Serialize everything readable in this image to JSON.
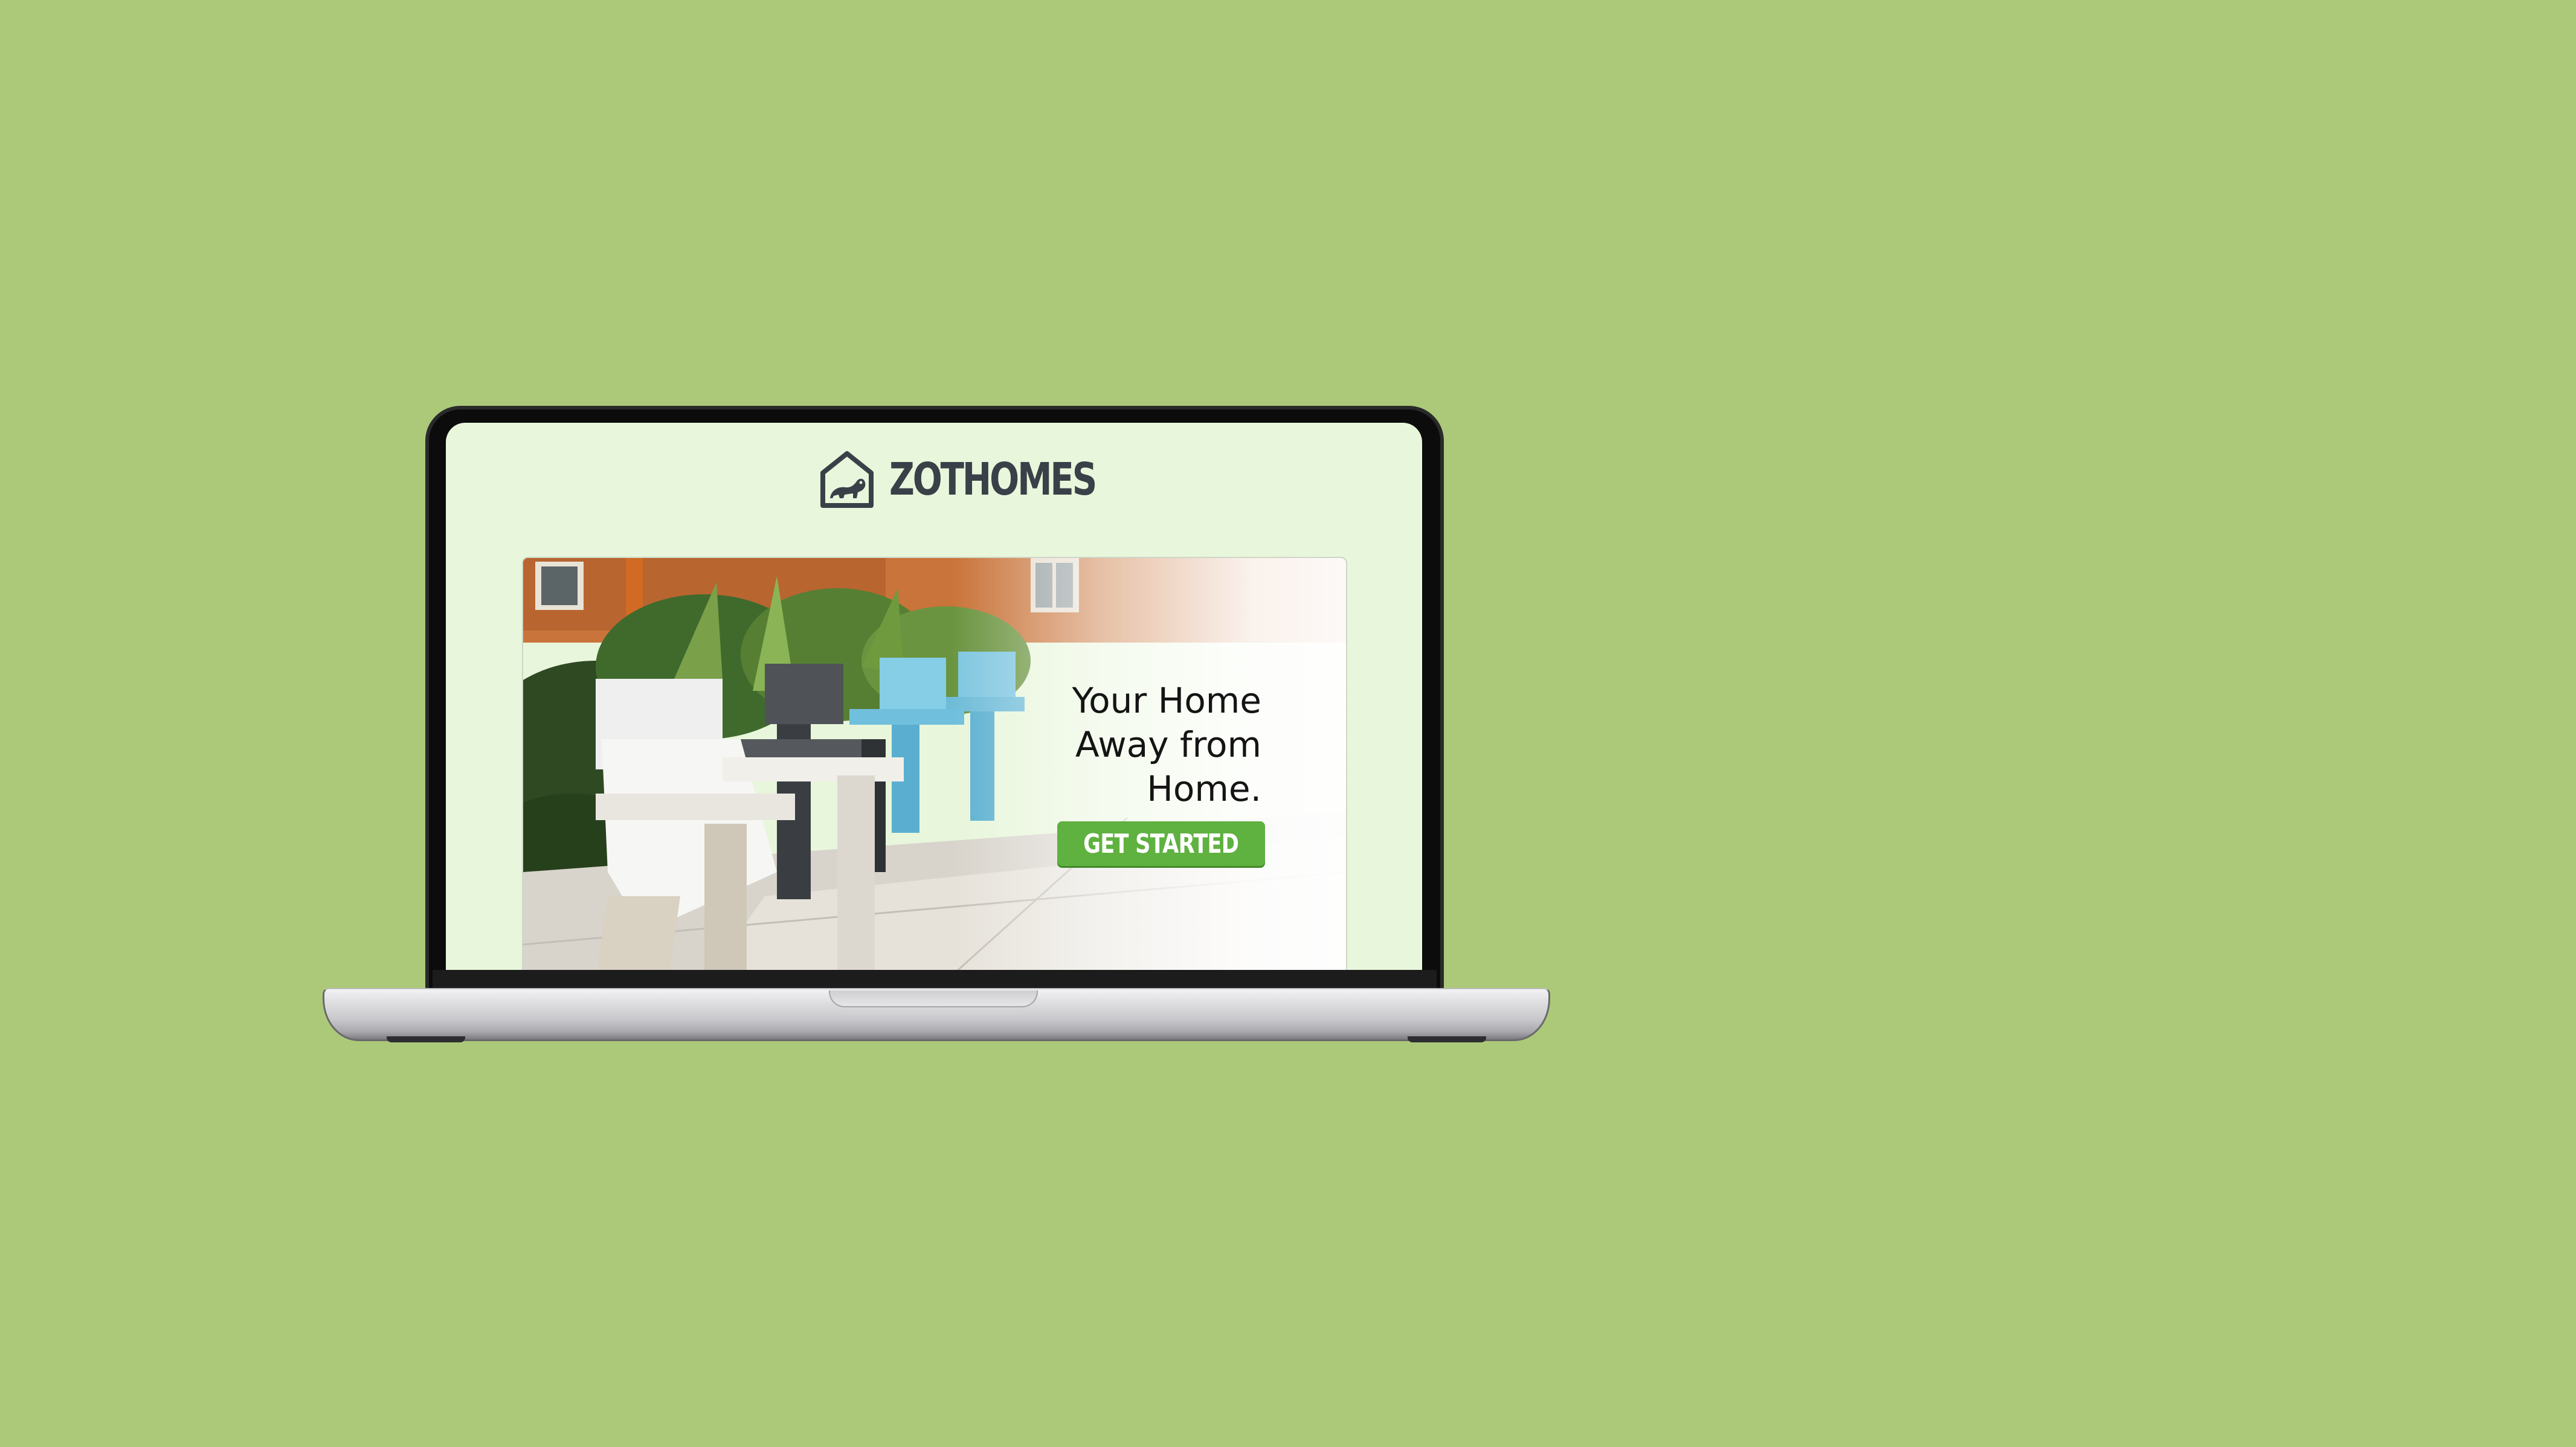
{
  "brand": {
    "name": "ZOTHOMES",
    "logo_icon": "house-anteater-icon"
  },
  "hero": {
    "headline": "Your Home Away from Home.",
    "cta_label": "GET STARTED",
    "image": "outdoor-adirondack-chairs-photo"
  },
  "colors": {
    "page_background": "#acc979",
    "screen_background": "#e8f6db",
    "cta_background": "#5fb140",
    "brand_text": "#3a4048"
  }
}
